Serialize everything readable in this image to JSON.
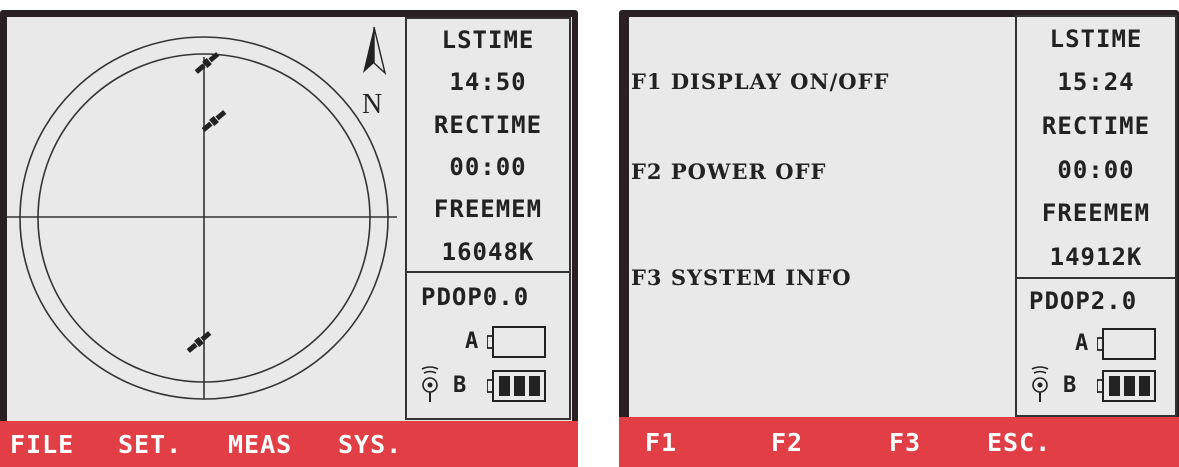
{
  "left_screen": {
    "north_label": "N",
    "status": {
      "lstime_label": "LSTIME",
      "lstime_value": "14:50",
      "rectime_label": "RECTIME",
      "rectime_value": "00:00",
      "freemem_label": "FREEMEM",
      "freemem_value": "16048K",
      "pdop": "PDOP0.0",
      "battery_a_label": "A",
      "battery_b_label": "B",
      "battery_a_level_bars": 0,
      "battery_b_level_bars": 3
    },
    "softkeys": [
      "FILE",
      "SET.",
      "MEAS",
      "SYS."
    ]
  },
  "right_screen": {
    "menu": [
      {
        "key": "F1",
        "label": "DISPLAY ON/OFF"
      },
      {
        "key": "F2",
        "label": "POWER OFF"
      },
      {
        "key": "F3",
        "label": "SYSTEM INFO"
      }
    ],
    "status": {
      "lstime_label": "LSTIME",
      "lstime_value": "15:24",
      "rectime_label": "RECTIME",
      "rectime_value": "00:00",
      "freemem_label": "FREEMEM",
      "freemem_value": "14912K",
      "pdop": "PDOP2.0",
      "battery_a_label": "A",
      "battery_b_label": "B",
      "battery_a_level_bars": 0,
      "battery_b_level_bars": 3
    },
    "softkeys": [
      "F1",
      "F2",
      "F3",
      "ESC."
    ]
  },
  "colors": {
    "lcd_background": "#e9e9e9",
    "softkey_bar": "#e23e46",
    "bezel": "#2a1f22",
    "ink": "#222222"
  }
}
